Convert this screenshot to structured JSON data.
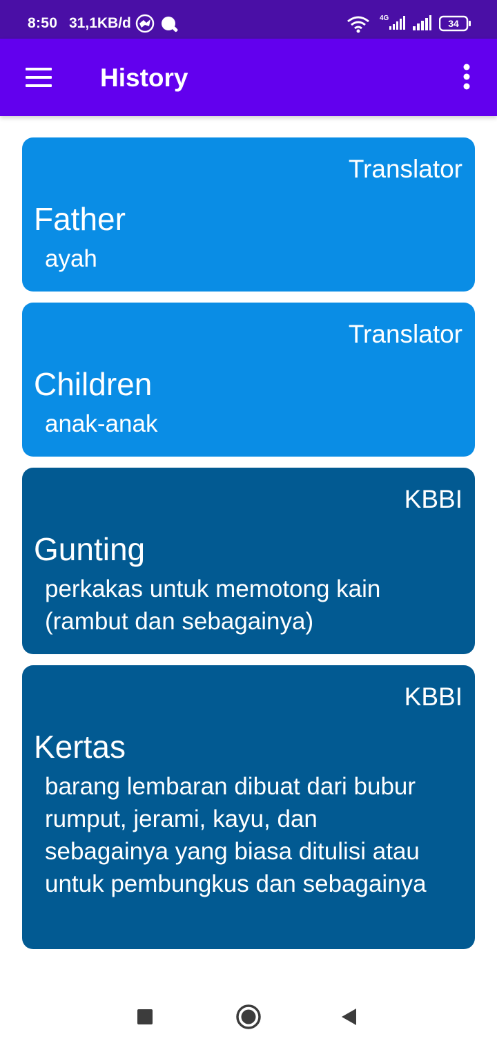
{
  "status_bar": {
    "time": "8:50",
    "speed": "31,1KB/d",
    "network_type": "4G",
    "battery_level": "34",
    "icons": [
      "vpn-icon",
      "search-notification-icon",
      "wifi-icon",
      "signal-4g-icon",
      "signal-icon",
      "battery-icon"
    ]
  },
  "app_bar": {
    "title": "History",
    "background": "#6200ee",
    "icons": [
      "menu-icon",
      "more-vert-icon"
    ]
  },
  "colors": {
    "status_bar_bg": "#4a0fa6",
    "translator_card_bg": "#0a8de5",
    "kbbi_card_bg": "#025a92",
    "nav_icon": "#3c3c3c"
  },
  "history": [
    {
      "source": "Translator",
      "word": "Father",
      "meaning": "ayah"
    },
    {
      "source": "Translator",
      "word": "Children",
      "meaning": "anak-anak"
    },
    {
      "source": "KBBI",
      "word": "Gunting",
      "meaning": "perkakas untuk memotong kain (rambut dan sebagainya)"
    },
    {
      "source": "KBBI",
      "word": "Kertas",
      "meaning": "barang lembaran dibuat dari bubur rumput, jerami, kayu, dan sebagainya yang biasa ditulisi atau untuk pembungkus dan sebagainya"
    }
  ],
  "nav_bar": {
    "icons": [
      "recents-square-icon",
      "home-circle-icon",
      "back-triangle-icon"
    ]
  }
}
